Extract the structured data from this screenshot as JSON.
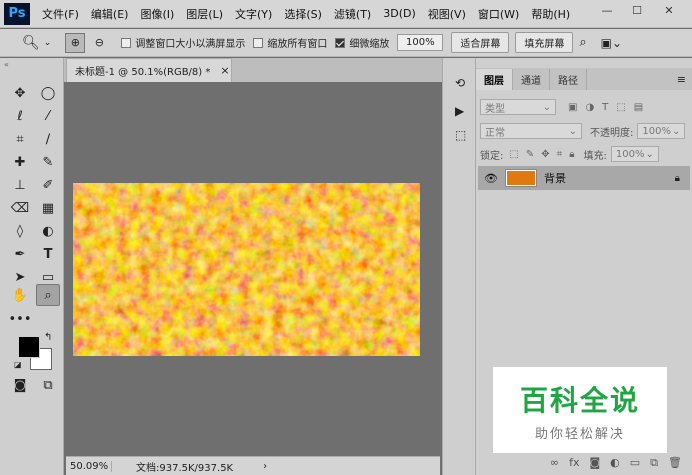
{
  "app": {
    "logo": "Ps"
  },
  "menu": [
    "文件(F)",
    "编辑(E)",
    "图像(I)",
    "图层(L)",
    "文字(Y)",
    "选择(S)",
    "滤镜(T)",
    "3D(D)",
    "视图(V)",
    "窗口(W)",
    "帮助(H)"
  ],
  "window_controls": {
    "minimize": "—",
    "maximize": "☐",
    "close": "✕"
  },
  "options": {
    "resize_windows_label": "调整窗口大小以满屏显示",
    "zoom_all_label": "缩放所有窗口",
    "scrubby_zoom_label": "细微缩放",
    "zoom_value": "100%",
    "fit_screen_label": "适合屏幕",
    "fill_screen_label": "填充屏幕"
  },
  "document": {
    "tab_title": "未标题-1 @ 50.1%(RGB/8) *",
    "close": "×"
  },
  "status": {
    "zoom": "50.09%",
    "doc_size": "文档:937.5K/937.5K",
    "arrow": "›"
  },
  "layers_panel": {
    "tabs": [
      "图层",
      "通道",
      "路径"
    ],
    "filter_kind": "类型",
    "blend_mode": "正常",
    "opacity_label": "不透明度:",
    "opacity_value": "100%",
    "lock_label": "锁定:",
    "fill_label": "填充:",
    "fill_value": "100%",
    "layers": [
      {
        "name": "背景",
        "visible": true,
        "locked": true
      }
    ]
  },
  "watermark": {
    "title": "百科全说",
    "subtitle": "助你轻松解决"
  },
  "colors": {
    "foreground": "#000000",
    "background": "#ffffff",
    "brand": "#21a544",
    "fire": "#e07a10"
  },
  "tools": {
    "move": "move-icon",
    "marquee": "elliptical-marquee-icon",
    "lasso": "lasso-icon",
    "quick_select": "magic-wand-icon",
    "crop": "crop-icon",
    "eyedropper": "eyedropper-icon",
    "healing": "healing-brush-icon",
    "brush": "brush-icon",
    "stamp": "clone-stamp-icon",
    "history_brush": "history-brush-icon",
    "eraser": "eraser-icon",
    "gradient": "gradient-icon",
    "blur": "blur-icon",
    "dodge": "dodge-icon",
    "pen": "pen-icon",
    "type": "type-icon",
    "path_select": "path-selection-icon",
    "shape": "rectangle-icon",
    "hand": "hand-icon",
    "zoom": "zoom-icon"
  }
}
